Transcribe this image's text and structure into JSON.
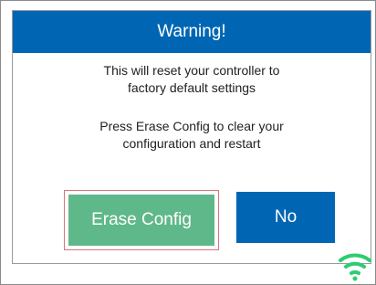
{
  "dialog": {
    "title": "Warning!",
    "message1": {
      "line1": "This will reset your controller to",
      "line2": "factory default settings"
    },
    "message2": {
      "line1": "Press Erase Config to clear your",
      "line2": "configuration and restart"
    },
    "erase_button_label": "Erase Config",
    "no_button_label": "No"
  },
  "icons": {
    "status": "wifi-icon"
  },
  "colors": {
    "header": "#0066b3",
    "erase_button": "#5fb88a",
    "no_button": "#0066b3",
    "focus_ring": "#d9747a",
    "wifi": "#2ecc71"
  }
}
